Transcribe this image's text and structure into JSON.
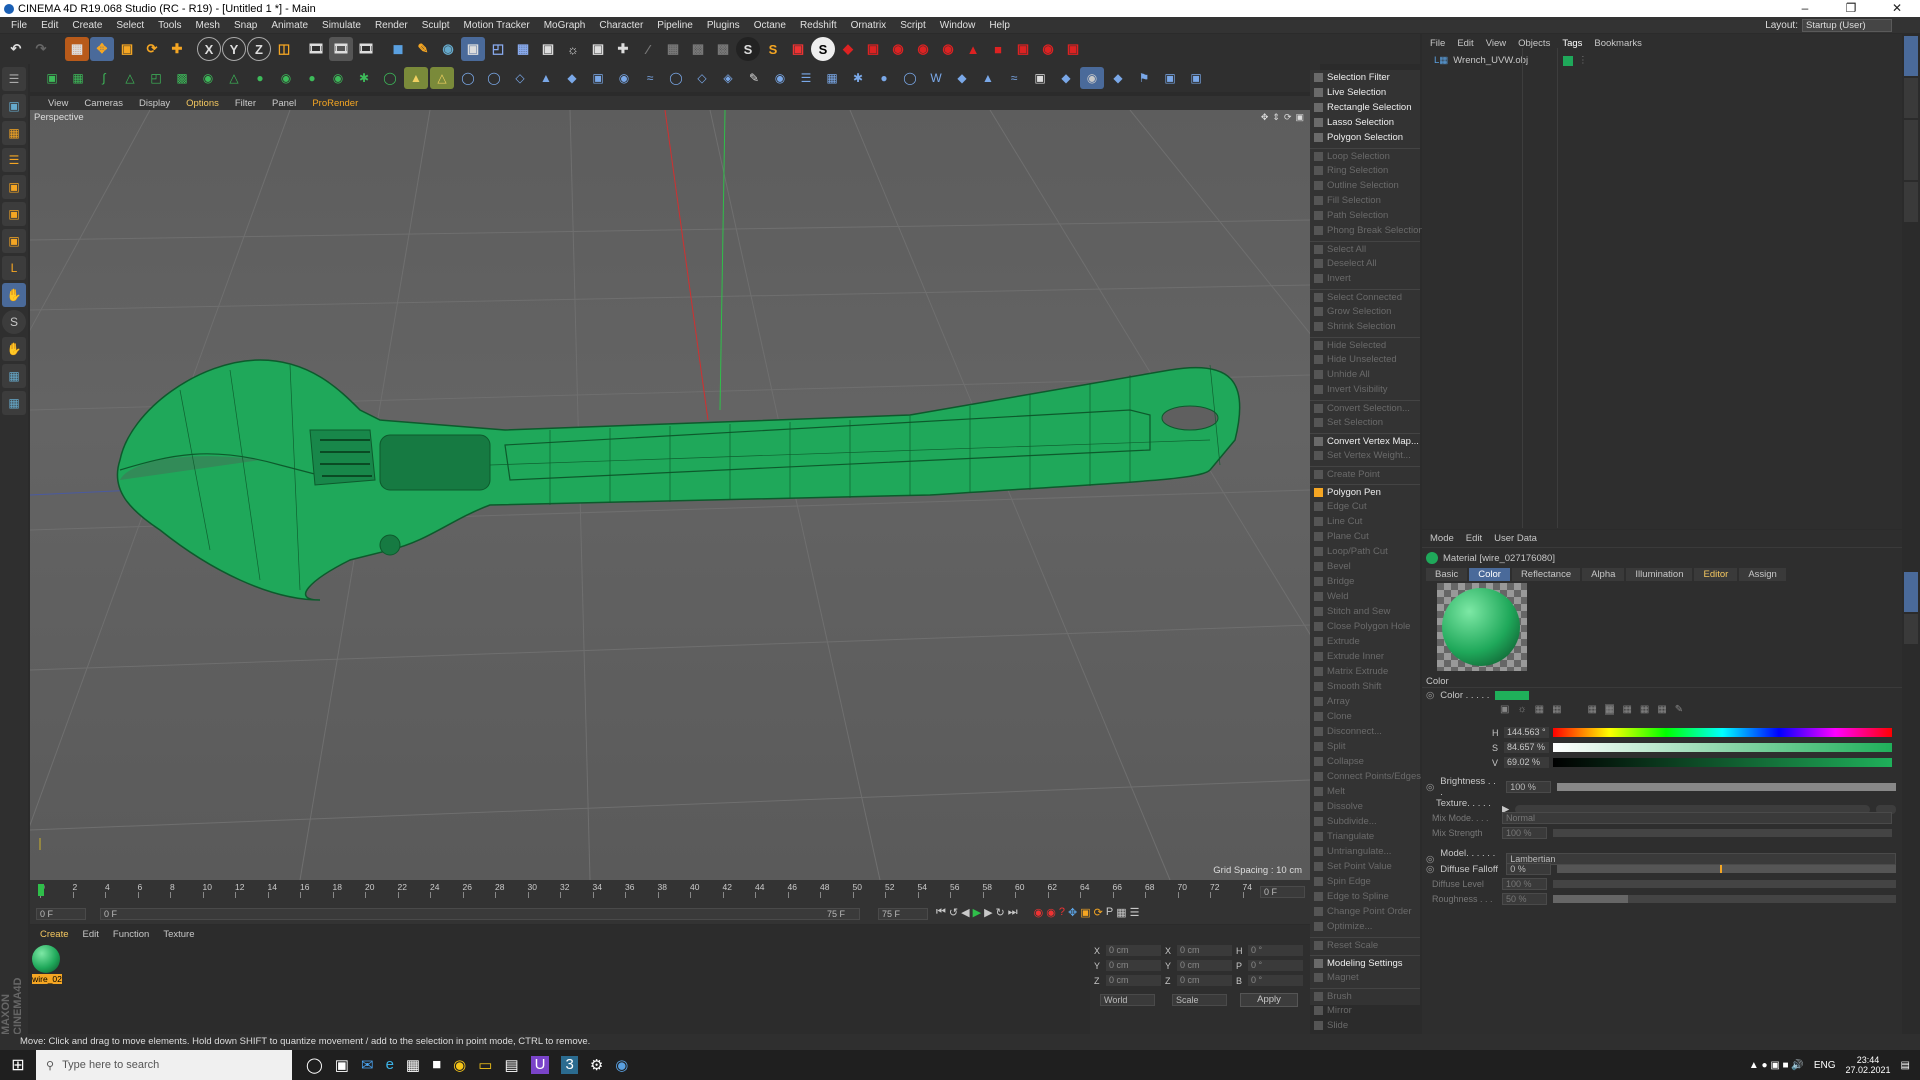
{
  "window": {
    "title": "CINEMA 4D R19.068 Studio (RC - R19) - [Untitled 1 *] - Main"
  },
  "menubar": [
    "File",
    "Edit",
    "Create",
    "Select",
    "Tools",
    "Mesh",
    "Snap",
    "Animate",
    "Simulate",
    "Render",
    "Sculpt",
    "Motion Tracker",
    "MoGraph",
    "Character",
    "Pipeline",
    "Plugins",
    "Octane",
    "Redshift",
    "Ornatrix",
    "Script",
    "Window",
    "Help"
  ],
  "layout": {
    "label": "Layout:",
    "value": "Startup (User)"
  },
  "viewport": {
    "menu": [
      "View",
      "Cameras",
      "Display",
      "Options",
      "Filter",
      "Panel",
      "ProRender"
    ],
    "label": "Perspective",
    "grid_spacing": "Grid Spacing : 10 cm",
    "object_color": "#1fa85a"
  },
  "timeline": {
    "ticks": [
      "0",
      "2",
      "4",
      "6",
      "8",
      "10",
      "12",
      "14",
      "16",
      "18",
      "20",
      "22",
      "24",
      "26",
      "28",
      "30",
      "32",
      "34",
      "36",
      "38",
      "40",
      "42",
      "44",
      "46",
      "48",
      "50",
      "52",
      "54",
      "56",
      "58",
      "60",
      "62",
      "64",
      "66",
      "68",
      "70",
      "72",
      "74"
    ],
    "current_frame": "0 F",
    "start": "0 F",
    "range_start": "0 F",
    "range_end": "75 F",
    "end": "75 F"
  },
  "material_manager": {
    "menu": [
      "Create",
      "Edit",
      "Function",
      "Texture"
    ],
    "material_name": "wire_02"
  },
  "coords": {
    "labels": [
      "X",
      "Y",
      "Z"
    ],
    "rot_labels": [
      "H",
      "P",
      "B"
    ],
    "value": "0 cm",
    "rot_value": "0 °",
    "mode1": "World",
    "mode2": "Scale",
    "apply": "Apply"
  },
  "selection_menu": {
    "items": [
      {
        "label": "Selection Filter",
        "enabled": true
      },
      {
        "label": "Live Selection",
        "enabled": true
      },
      {
        "label": "Rectangle Selection",
        "enabled": true
      },
      {
        "label": "Lasso Selection",
        "enabled": true
      },
      {
        "label": "Polygon Selection",
        "enabled": true
      },
      {
        "label": "Loop Selection",
        "enabled": false
      },
      {
        "label": "Ring Selection",
        "enabled": false
      },
      {
        "label": "Outline Selection",
        "enabled": false
      },
      {
        "label": "Fill Selection",
        "enabled": false
      },
      {
        "label": "Path Selection",
        "enabled": false
      },
      {
        "label": "Phong Break Selection",
        "enabled": false
      },
      {
        "label": "Select All",
        "enabled": false
      },
      {
        "label": "Deselect All",
        "enabled": false
      },
      {
        "label": "Invert",
        "enabled": false
      },
      {
        "label": "Select Connected",
        "enabled": false
      },
      {
        "label": "Grow Selection",
        "enabled": false
      },
      {
        "label": "Shrink Selection",
        "enabled": false
      },
      {
        "label": "Hide Selected",
        "enabled": false
      },
      {
        "label": "Hide Unselected",
        "enabled": false
      },
      {
        "label": "Unhide All",
        "enabled": false
      },
      {
        "label": "Invert Visibility",
        "enabled": false
      },
      {
        "label": "Convert Selection...",
        "enabled": false
      },
      {
        "label": "Set Selection",
        "enabled": false
      },
      {
        "label": "Convert Vertex Map...",
        "enabled": true
      },
      {
        "label": "Set Vertex Weight...",
        "enabled": false
      },
      {
        "label": "Create Point",
        "enabled": false
      },
      {
        "label": "Polygon Pen",
        "enabled": true
      },
      {
        "label": "Edge Cut",
        "enabled": false
      },
      {
        "label": "Line Cut",
        "enabled": false
      },
      {
        "label": "Plane Cut",
        "enabled": false
      },
      {
        "label": "Loop/Path Cut",
        "enabled": false
      },
      {
        "label": "Bevel",
        "enabled": false
      },
      {
        "label": "Bridge",
        "enabled": false
      },
      {
        "label": "Weld",
        "enabled": false
      },
      {
        "label": "Stitch and Sew",
        "enabled": false
      },
      {
        "label": "Close Polygon Hole",
        "enabled": false
      },
      {
        "label": "Extrude",
        "enabled": false
      },
      {
        "label": "Extrude Inner",
        "enabled": false
      },
      {
        "label": "Matrix Extrude",
        "enabled": false
      },
      {
        "label": "Smooth Shift",
        "enabled": false
      },
      {
        "label": "Array",
        "enabled": false
      },
      {
        "label": "Clone",
        "enabled": false
      },
      {
        "label": "Disconnect...",
        "enabled": false
      },
      {
        "label": "Split",
        "enabled": false
      },
      {
        "label": "Collapse",
        "enabled": false
      },
      {
        "label": "Connect Points/Edges",
        "enabled": false
      },
      {
        "label": "Melt",
        "enabled": false
      },
      {
        "label": "Dissolve",
        "enabled": false
      },
      {
        "label": "Subdivide...",
        "enabled": false
      },
      {
        "label": "Triangulate",
        "enabled": false
      },
      {
        "label": "Untriangulate...",
        "enabled": false
      },
      {
        "label": "Set Point Value",
        "enabled": false
      },
      {
        "label": "Spin Edge",
        "enabled": false
      },
      {
        "label": "Edge to Spline",
        "enabled": false
      },
      {
        "label": "Change Point Order",
        "enabled": false
      },
      {
        "label": "Optimize...",
        "enabled": false
      },
      {
        "label": "Reset Scale",
        "enabled": false
      },
      {
        "label": "Modeling Settings",
        "enabled": true
      },
      {
        "label": "Magnet",
        "enabled": false
      },
      {
        "label": "Brush",
        "enabled": false
      },
      {
        "label": "Mirror",
        "enabled": false
      },
      {
        "label": "Slide",
        "enabled": false
      }
    ]
  },
  "object_manager": {
    "menu": [
      "File",
      "Edit",
      "View",
      "Objects",
      "Tags",
      "Bookmarks"
    ],
    "object_name": "Wrench_UVW.obj"
  },
  "attributes": {
    "menu": [
      "Mode",
      "Edit",
      "User Data"
    ],
    "title": "Material [wire_027176080]",
    "tabs": [
      "Basic",
      "Color",
      "Reflectance",
      "Alpha",
      "Illumination",
      "Editor",
      "Assign"
    ],
    "active_tab": "Color",
    "section": "Color",
    "color_label": "Color . . . . .",
    "swatch_color": "#1fb05a",
    "hsv": [
      {
        "label": "H",
        "value": "144.563 °"
      },
      {
        "label": "S",
        "value": "84.657 %"
      },
      {
        "label": "V",
        "value": "69.02 %"
      }
    ],
    "brightness_label": "Brightness . . .",
    "brightness": "100 %",
    "texture_label": "Texture. . . . . .",
    "mix_mode_label": "Mix Mode. . . .",
    "mix_mode": "Normal",
    "mix_strength_label": "Mix Strength",
    "mix_strength": "100 %",
    "model_label": "Model. . . . . . .",
    "model": "Lambertian",
    "diffuse_falloff_label": "Diffuse Falloff",
    "diffuse_falloff": "0 %",
    "diffuse_level_label": "Diffuse Level",
    "diffuse_level": "100 %",
    "roughness_label": "Roughness . . .",
    "roughness": "50 %"
  },
  "status": "Move: Click and drag to move elements. Hold down SHIFT to quantize movement / add to the selection in point mode, CTRL to remove.",
  "taskbar": {
    "search_placeholder": "Type here to search",
    "lang": "ENG",
    "time": "23:44",
    "date": "27.02.2021"
  }
}
